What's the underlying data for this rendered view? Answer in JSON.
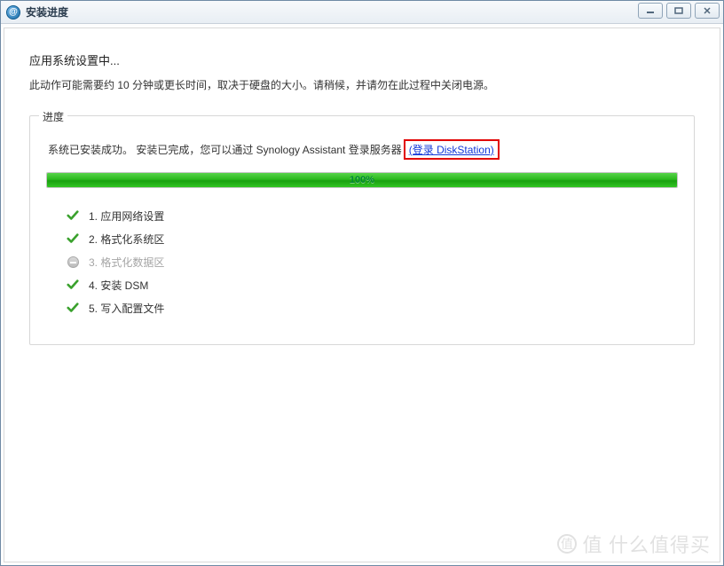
{
  "window": {
    "title": "安装进度"
  },
  "heading": "应用系统设置中...",
  "subtext": "此动作可能需要约 10 分钟或更长时间，取决于硬盘的大小。请稍候，并请勿在此过程中关闭电源。",
  "fieldset": {
    "legend": "进度"
  },
  "status": {
    "text": "系统已安装成功。 安装已完成，您可以通过 Synology Assistant 登录服务器",
    "link_text": "(登录 DiskStation)"
  },
  "progress": {
    "percent": 100,
    "label": "100%"
  },
  "steps": [
    {
      "num": "1.",
      "label": "应用网络设置",
      "state": "done"
    },
    {
      "num": "2.",
      "label": "格式化系统区",
      "state": "done"
    },
    {
      "num": "3.",
      "label": "格式化数据区",
      "state": "skipped"
    },
    {
      "num": "4.",
      "label": "安装 DSM",
      "state": "done"
    },
    {
      "num": "5.",
      "label": "写入配置文件",
      "state": "done"
    }
  ],
  "watermark": "值 什么值得买"
}
